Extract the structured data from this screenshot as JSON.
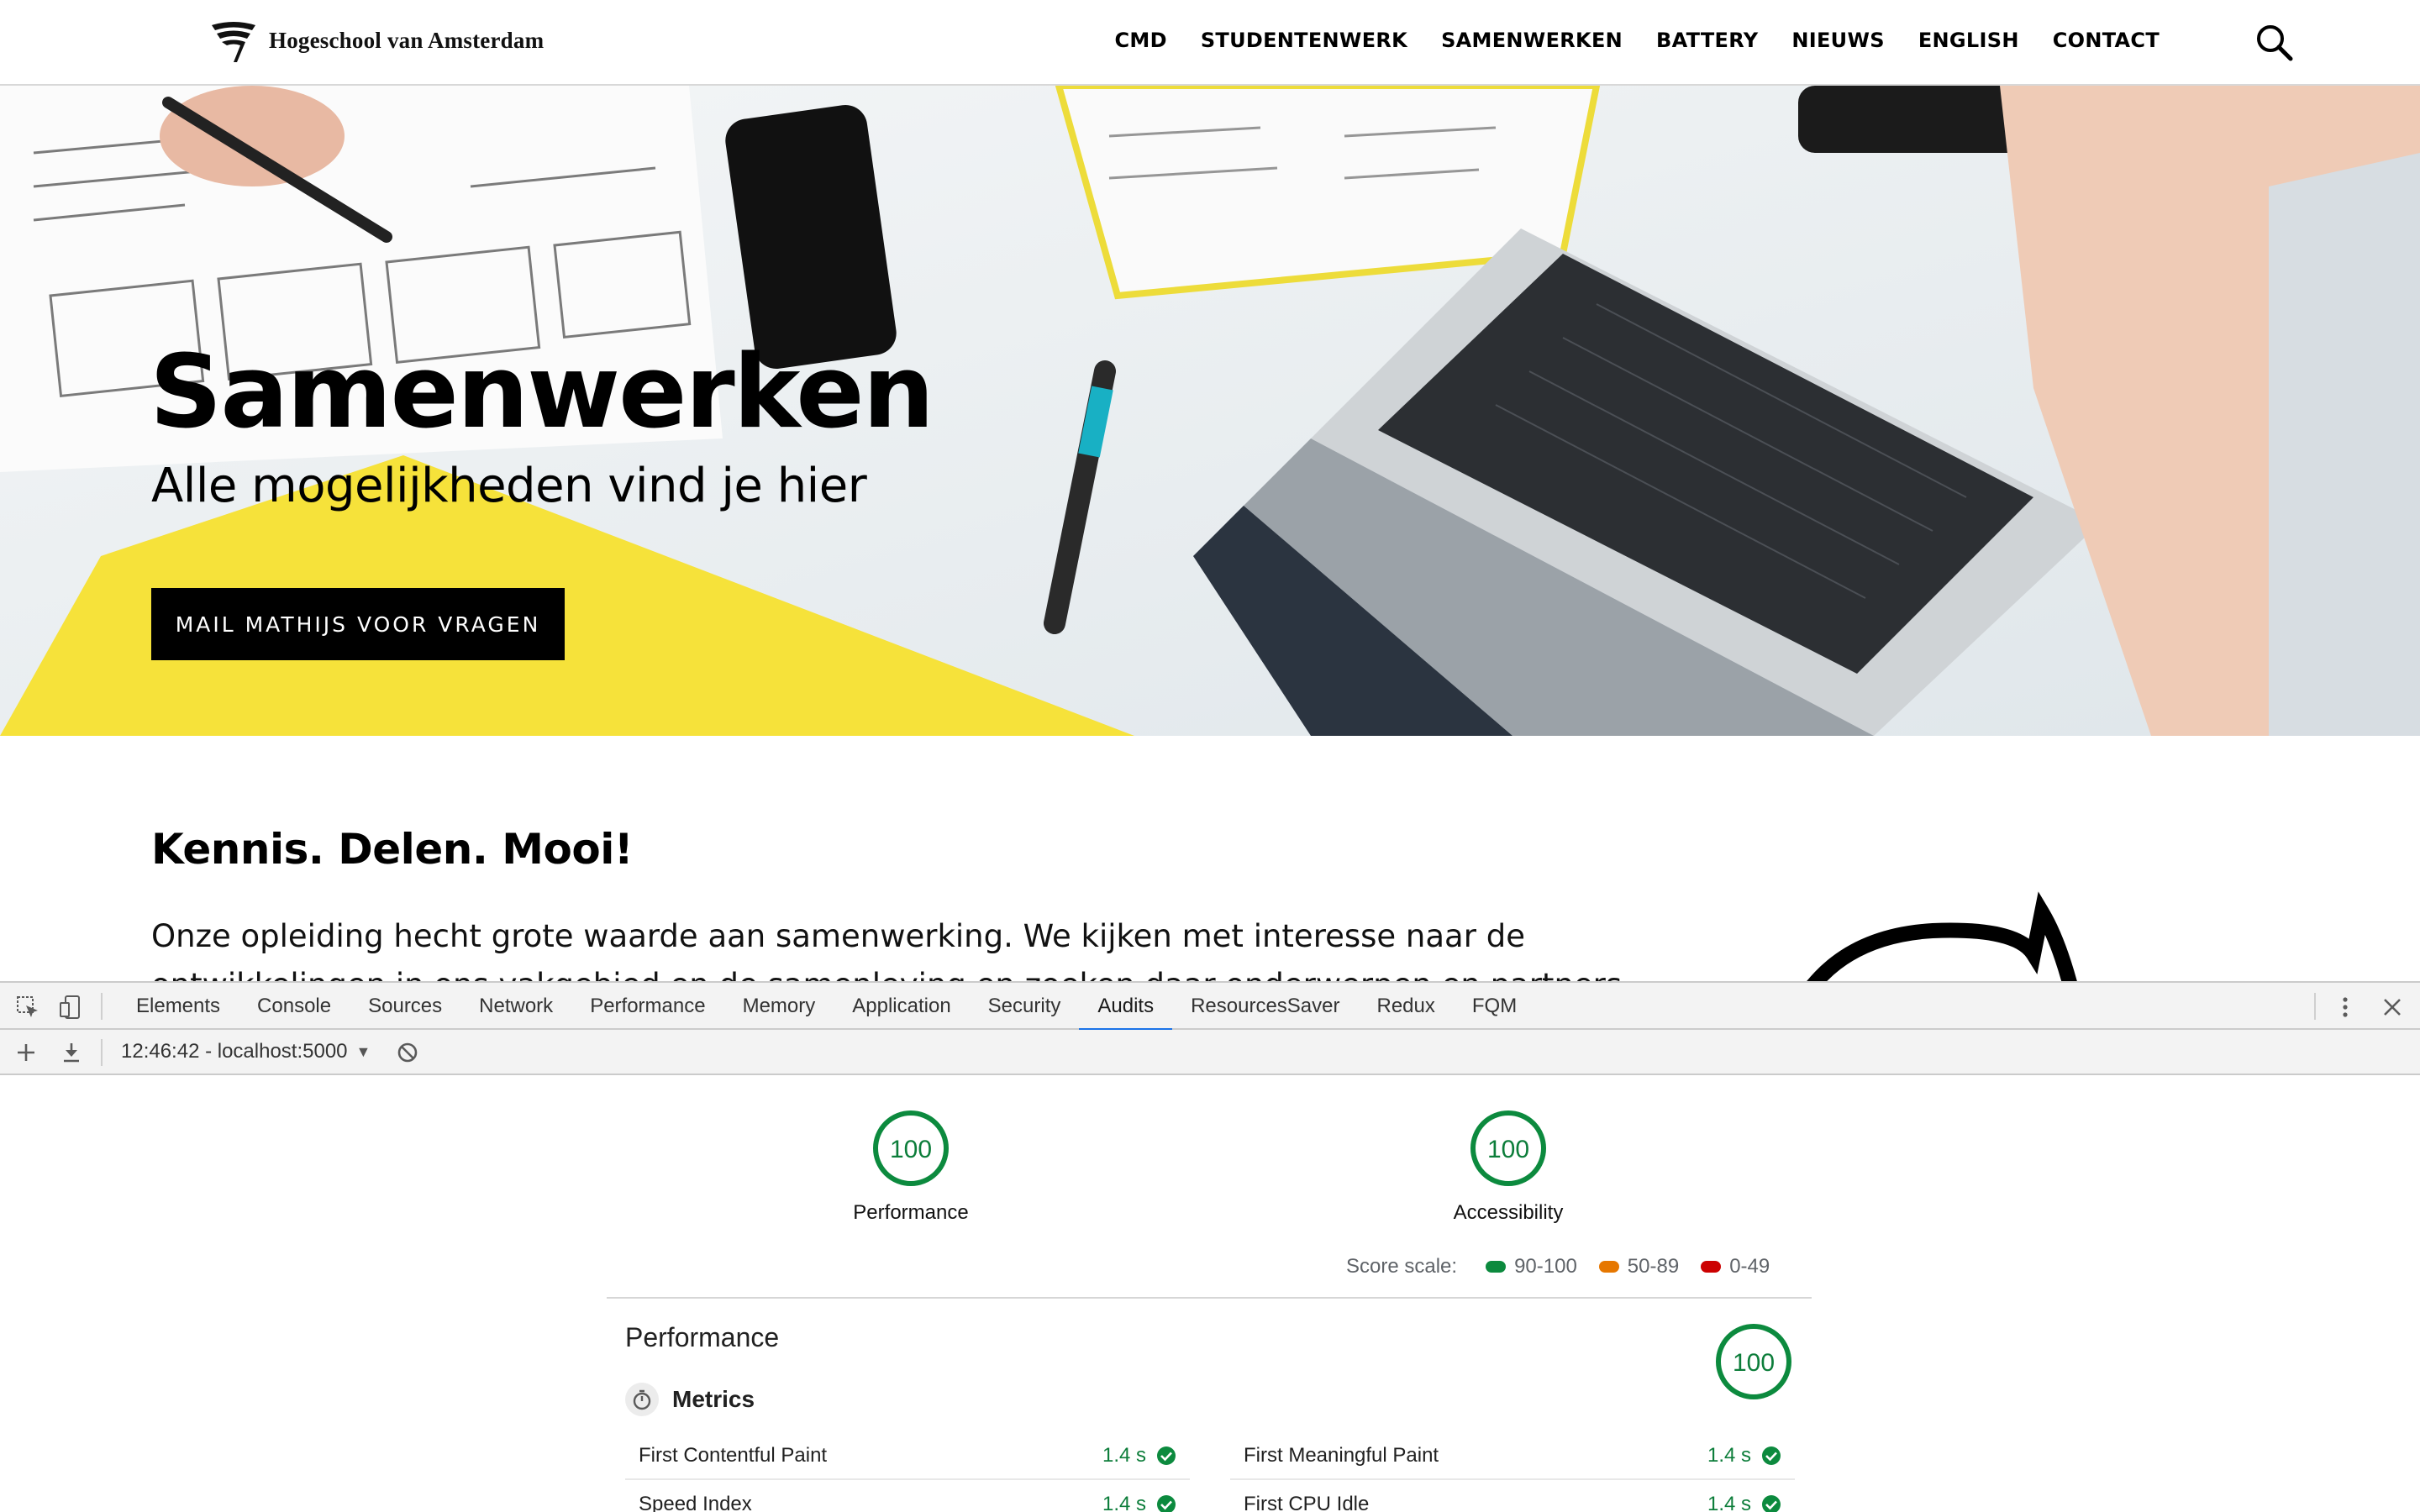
{
  "site": {
    "logo_text": "Hogeschool van Amsterdam",
    "nav": [
      "CMD",
      "STUDENTENWERK",
      "SAMENWERKEN",
      "BATTERY",
      "NIEUWS",
      "ENGLISH",
      "CONTACT"
    ]
  },
  "hero": {
    "title": "Samenwerken",
    "subtitle": "Alle mogelijkheden vind je hier",
    "button": "MAIL MATHIJS VOOR VRAGEN"
  },
  "content": {
    "heading": "Kennis. Delen. Mooi!",
    "body": "Onze opleiding hecht grote waarde aan samenwerking. We kijken met interesse naar de ontwikkelingen in ons vakgebied en de samenleving en zoeken daar onderwerpen en partners"
  },
  "devtools": {
    "tabs": [
      "Elements",
      "Console",
      "Sources",
      "Network",
      "Performance",
      "Memory",
      "Application",
      "Security",
      "Audits",
      "ResourcesSaver",
      "Redux",
      "FQM"
    ],
    "active_tab": "Audits",
    "report_select": "12:46:42 - localhost:5000",
    "gauges": [
      {
        "score": "100",
        "label": "Performance"
      },
      {
        "score": "100",
        "label": "Accessibility"
      }
    ],
    "score_scale": {
      "label": "Score scale:",
      "ranges": [
        {
          "label": "90-100",
          "color": "#0c8a3e"
        },
        {
          "label": "50-89",
          "color": "#e67700"
        },
        {
          "label": "0-49",
          "color": "#cc0000"
        }
      ]
    },
    "performance": {
      "title": "Performance",
      "score": "100",
      "metrics_heading": "Metrics",
      "metrics": [
        {
          "name": "First Contentful Paint",
          "value": "1.4 s"
        },
        {
          "name": "First Meaningful Paint",
          "value": "1.4 s"
        },
        {
          "name": "Speed Index",
          "value": "1.4 s"
        },
        {
          "name": "First CPU Idle",
          "value": "1.4 s"
        }
      ]
    }
  }
}
